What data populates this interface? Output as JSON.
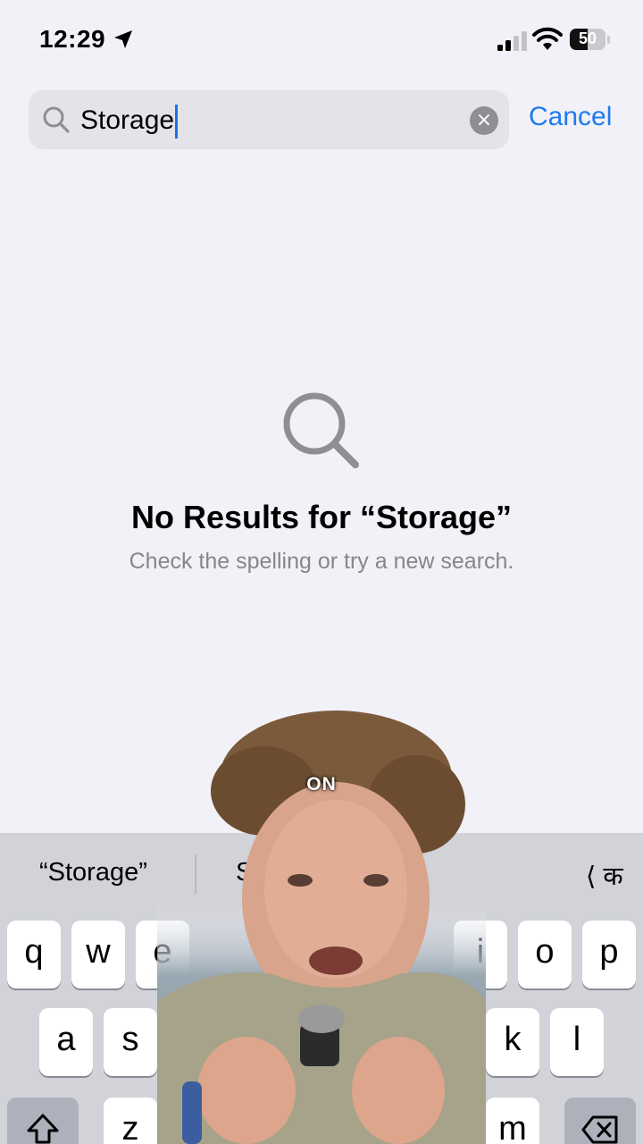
{
  "status_bar": {
    "time": "12:29",
    "battery": "50",
    "battery_level": 0.5
  },
  "search": {
    "value": "Storage",
    "cancel_label": "Cancel"
  },
  "empty_state": {
    "title": "No Results for “Storage”",
    "subtitle": "Check the spelling or try a new search."
  },
  "keyboard": {
    "suggestions": [
      "“Storage”",
      "Sto",
      "⟨ क"
    ],
    "row1": [
      "q",
      "w",
      "e",
      "i",
      "o",
      "p"
    ],
    "row2": [
      "a",
      "s",
      "k",
      "l"
    ],
    "row3": [
      "z",
      "m"
    ]
  },
  "overlay": {
    "caption": "ON"
  },
  "colors": {
    "accent": "#1d7bf0",
    "background": "#f2f1f7",
    "keyboard": "#d1d3d9"
  }
}
